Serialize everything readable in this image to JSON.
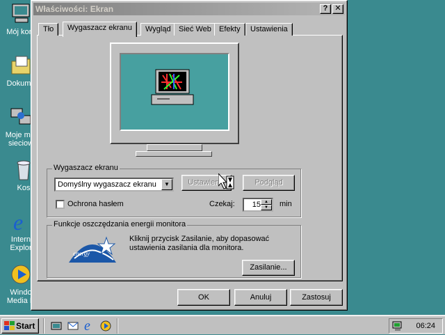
{
  "desktop": {
    "icons": [
      {
        "label": "Mój kom",
        "icon": "my-computer-icon"
      },
      {
        "label": "Dokume",
        "icon": "my-documents-icon"
      },
      {
        "label": "Moje mie",
        "label2": "sieciow",
        "icon": "network-neighborhood-icon"
      },
      {
        "label": "Kos",
        "icon": "recycle-bin-icon"
      },
      {
        "label": "Intern",
        "label2": "Explor",
        "icon": "internet-explorer-icon"
      },
      {
        "label": "Windo",
        "label2": "Media P",
        "icon": "windows-media-player-icon"
      }
    ]
  },
  "window": {
    "title": "Właściwości: Ekran",
    "help_button": "?",
    "close_button": "✕",
    "tabs": [
      "Tło",
      "Wygaszacz ekranu",
      "Wygląd",
      "Sieć Web",
      "Efekty",
      "Ustawienia"
    ],
    "active_tab": "Wygaszacz ekranu",
    "screensaver_group": {
      "label": "Wygaszacz ekranu",
      "selected": "Domyślny wygaszacz ekranu",
      "settings_button": "Ustawienia",
      "preview_button": "Podgląd",
      "password_label": "Ochrona hasłem",
      "password_checked": false,
      "wait_label": "Czekaj:",
      "wait_value": "15",
      "wait_unit": "min"
    },
    "energy_group": {
      "label": "Funkcje oszczędzania energii monitora",
      "text1": "Kliknij przycisk Zasilanie, aby dopasować",
      "text2": "ustawienia zasilania dla monitora.",
      "power_button": "Zasilanie...",
      "logo_text": "energy"
    },
    "buttons": {
      "ok": "OK",
      "cancel": "Anuluj",
      "apply": "Zastosuj"
    }
  },
  "taskbar": {
    "start_label": "Start",
    "clock": "06:24",
    "quicklaunch": [
      "show-desktop-icon",
      "outlook-express-icon",
      "internet-explorer-icon",
      "windows-media-player-icon"
    ]
  },
  "colors": {
    "desktop": "#3a8a8f",
    "face": "#c0c0c0",
    "screen": "#47a0a0"
  }
}
